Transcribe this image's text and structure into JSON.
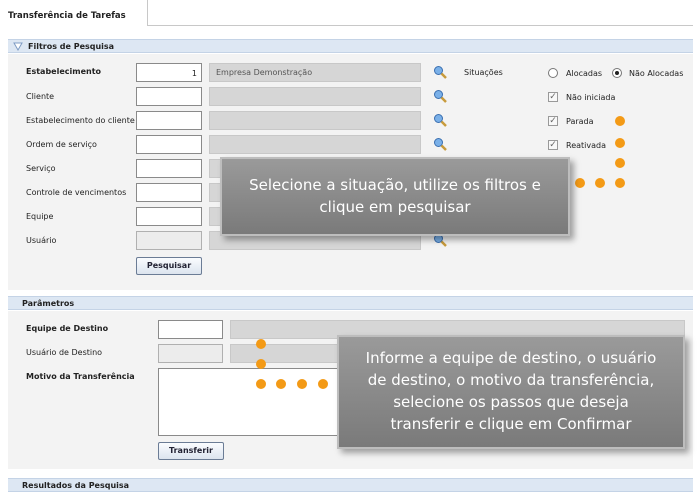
{
  "tab": {
    "label": "Transferência de Tarefas"
  },
  "filters": {
    "title": "Filtros de Pesquisa",
    "fields": [
      {
        "label": "Estabelecimento",
        "bold": true,
        "value": "1",
        "description": "Empresa Demonstração"
      },
      {
        "label": "Cliente",
        "value": "",
        "description": ""
      },
      {
        "label": "Estabelecimento do cliente",
        "value": "",
        "description": ""
      },
      {
        "label": "Ordem de serviço",
        "value": "",
        "description": ""
      },
      {
        "label": "Serviço",
        "value": "",
        "description": ""
      },
      {
        "label": "Controle de vencimentos",
        "value": "",
        "description": ""
      },
      {
        "label": "Equipe",
        "value": "",
        "description": ""
      },
      {
        "label": "Usuário",
        "value": "",
        "description": ""
      }
    ],
    "situacoes_label": "Situações",
    "radio_alocadas": "Alocadas",
    "radio_nao_alocadas": "Não Alocadas",
    "check_nao_iniciada": "Não iniciada",
    "check_parada": "Parada",
    "check_reativada": "Reativada",
    "search_button": "Pesquisar"
  },
  "params": {
    "title": "Parâmetros",
    "equipe_destino": "Equipe de Destino",
    "usuario_destino": "Usuário de Destino",
    "motivo": "Motivo da Transferência",
    "transfer_button": "Transferir"
  },
  "results": {
    "title": "Resultados da Pesquisa"
  },
  "callouts": {
    "filters_hint_1": "Selecione a situação, utilize os filtros e",
    "filters_hint_2": "clique em pesquisar",
    "params_hint_1": "Informe a equipe de destino, o usuário",
    "params_hint_2": "de destino, o motivo da transferência,",
    "params_hint_3": "selecione os passos que deseja",
    "params_hint_4": "transferir e clique em Confirmar"
  },
  "colors": {
    "accent_dot": "#f39a16",
    "section_header": "#dde7f3"
  }
}
